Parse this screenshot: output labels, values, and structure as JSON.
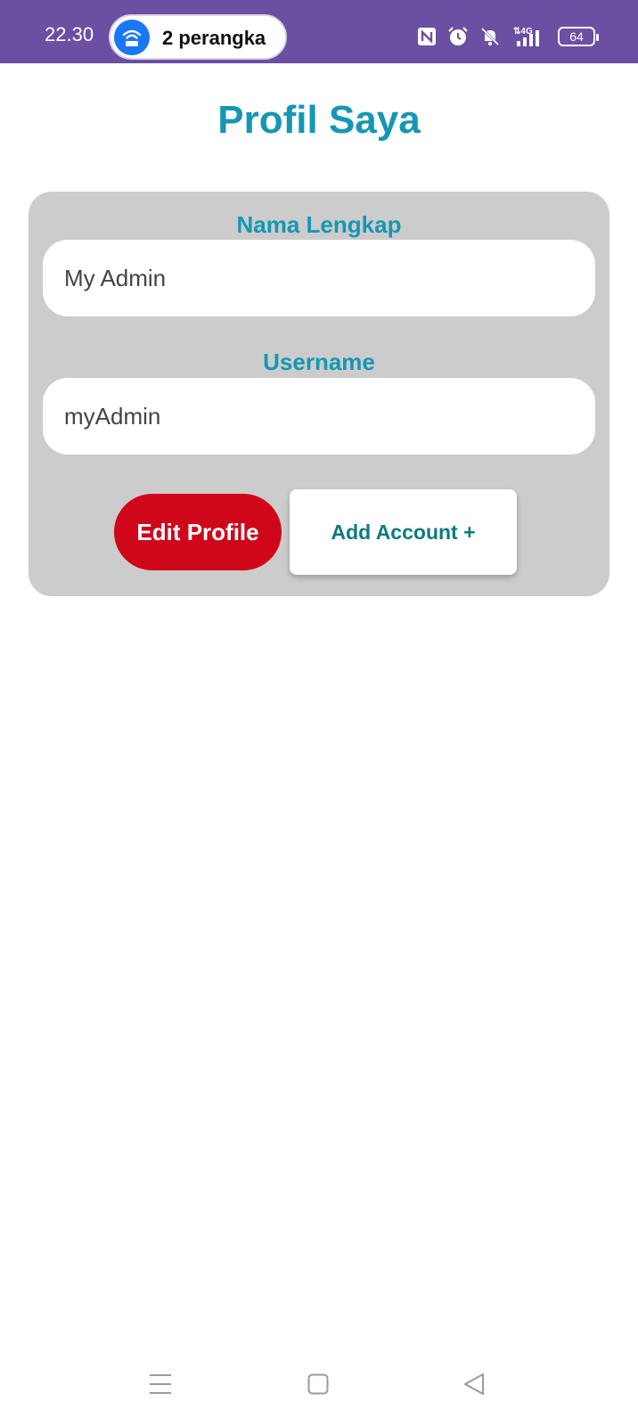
{
  "status_bar": {
    "time": "22.30",
    "hotspot_label": "2 perangka",
    "battery_level": "64",
    "icons": [
      "nfc-icon",
      "alarm-icon",
      "mute-icon",
      "signal-4g-icon",
      "battery-icon"
    ]
  },
  "page": {
    "title": "Profil Saya"
  },
  "form": {
    "name_label": "Nama Lengkap",
    "name_value": "My Admin",
    "username_label": "Username",
    "username_value": "myAdmin"
  },
  "actions": {
    "edit_label": "Edit Profile",
    "add_label": "Add Account +"
  },
  "colors": {
    "status_bar": "#6a4fa3",
    "accent": "#1597b3",
    "edit_button": "#d0061a",
    "add_button_text": "#0e7a80",
    "card": "#cccccc"
  },
  "nav": {
    "icons": [
      "menu-icon",
      "home-icon",
      "back-icon"
    ]
  }
}
